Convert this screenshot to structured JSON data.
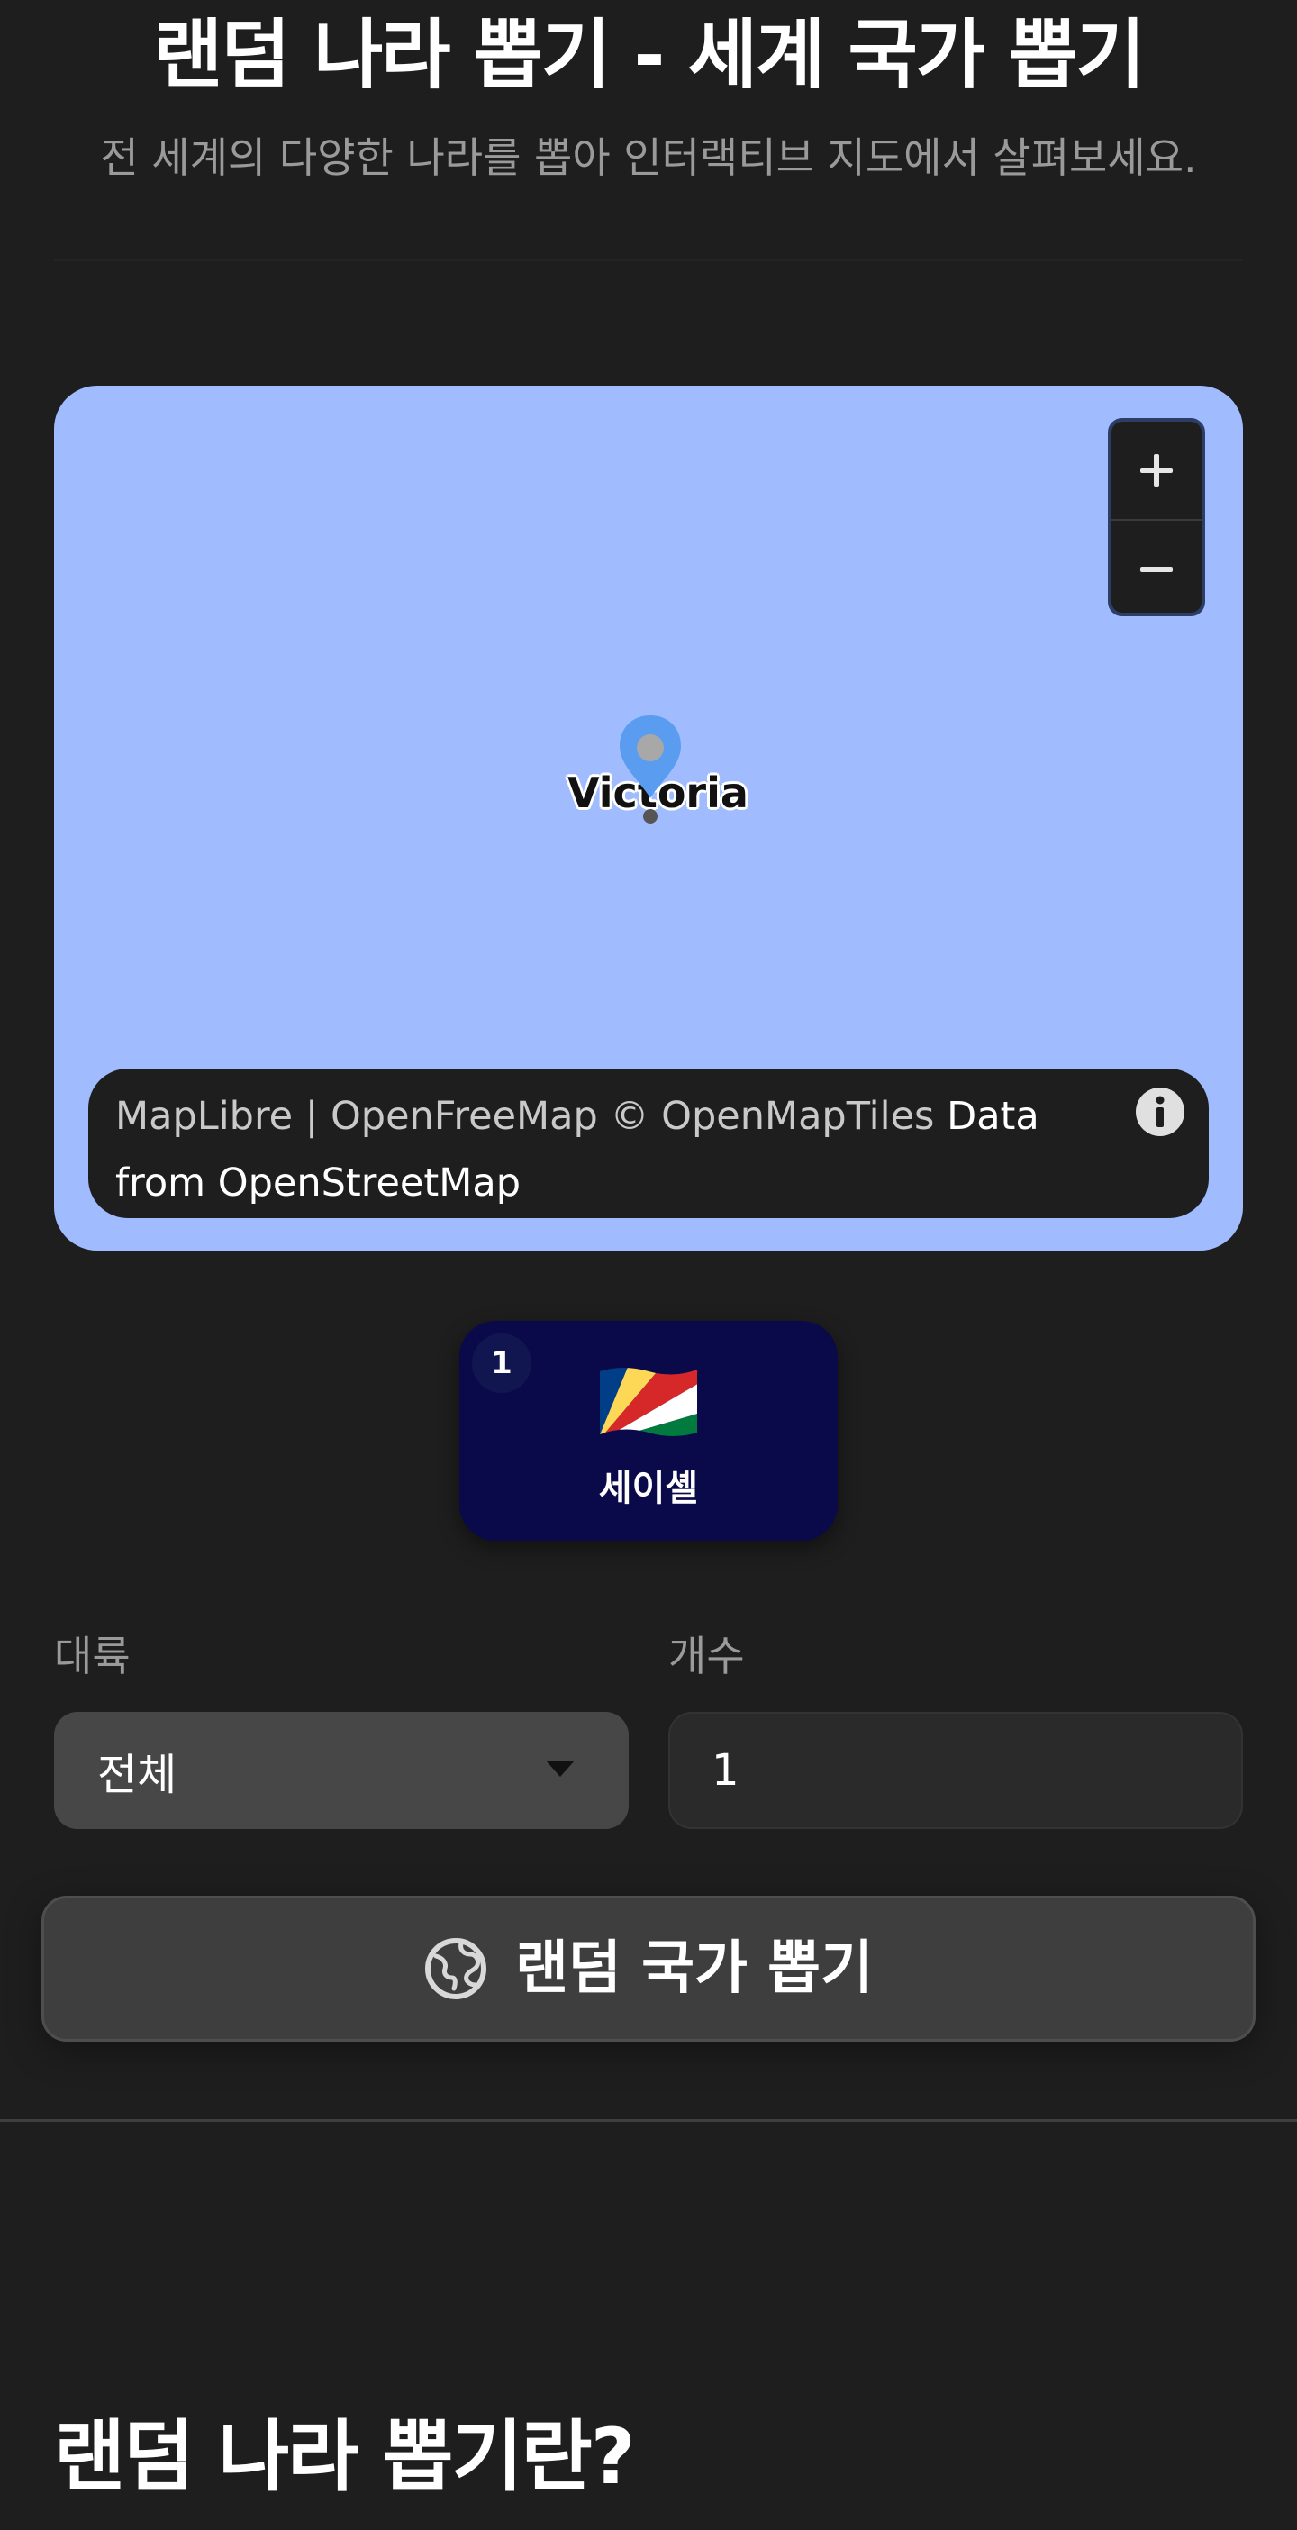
{
  "header": {
    "title": "랜덤 나라 뽑기 - 세계 국가 뽑기",
    "subtitle": "전 세계의 다양한 나라를 뽑아 인터랙티브 지도에서 살펴보세요."
  },
  "map": {
    "marker_label": "Victoria",
    "zoom_in_label": "+",
    "zoom_out_label": "−",
    "attribution": {
      "part1": "MapLibre | OpenFreeMap © OpenMapTiles ",
      "part2": "Data from OpenStreetMap"
    },
    "background_color": "#a0bcff",
    "marker_color": "#5a9cf0"
  },
  "result": {
    "index": "1",
    "country_name": "세이셸",
    "flag_icon": "seychelles-flag-icon"
  },
  "controls": {
    "continent_label": "대륙",
    "continent_value": "전체",
    "count_label": "개수",
    "count_value": "1"
  },
  "action": {
    "draw_label": "랜덤 국가 뽑기",
    "icon": "globe-icon"
  },
  "section": {
    "heading": "랜덤 나라 뽑기란?"
  }
}
